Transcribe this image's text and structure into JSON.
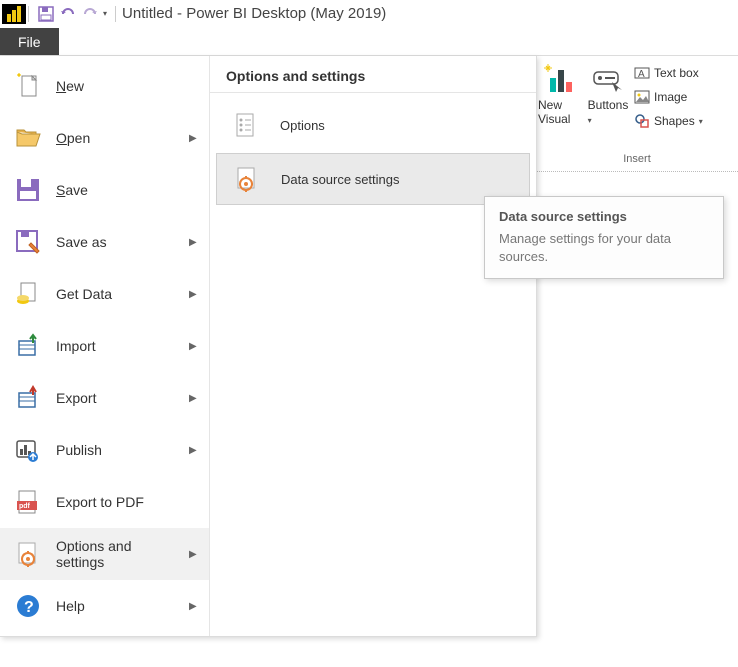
{
  "title": "Untitled - Power BI Desktop (May 2019)",
  "file_tab": "File",
  "menu": {
    "items": [
      {
        "label": "New",
        "hasSubmenu": false
      },
      {
        "label": "Open",
        "hasSubmenu": true
      },
      {
        "label": "Save",
        "hasSubmenu": false
      },
      {
        "label": "Save as",
        "hasSubmenu": true
      },
      {
        "label": "Get Data",
        "hasSubmenu": true
      },
      {
        "label": "Import",
        "hasSubmenu": true
      },
      {
        "label": "Export",
        "hasSubmenu": true
      },
      {
        "label": "Publish",
        "hasSubmenu": true
      },
      {
        "label": "Export to PDF",
        "hasSubmenu": false
      },
      {
        "label": "Options and settings",
        "hasSubmenu": true
      },
      {
        "label": "Help",
        "hasSubmenu": true
      }
    ]
  },
  "submenu": {
    "header": "Options and settings",
    "items": [
      {
        "label": "Options"
      },
      {
        "label": "Data source settings"
      }
    ]
  },
  "ribbon": {
    "new_visual": "New Visual",
    "buttons": "Buttons",
    "text_box": "Text box",
    "image": "Image",
    "shapes": "Shapes",
    "group_label": "Insert"
  },
  "tooltip": {
    "title": "Data source settings",
    "desc": "Manage settings for your data sources."
  }
}
